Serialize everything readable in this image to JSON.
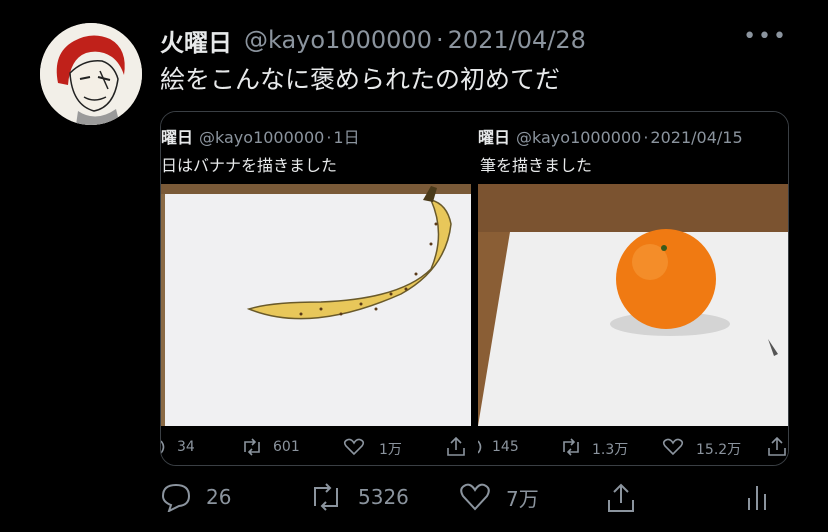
{
  "tweet": {
    "author_name": "火曜日",
    "handle": "@kayo1000000",
    "date": "2021/04/28",
    "text": "絵をこんなに褒められたの初めてだ"
  },
  "quoted": [
    {
      "name": "曜日",
      "handle": "@kayo1000000",
      "time": "1日",
      "text": "日はバナナを描きました",
      "replies": "34",
      "retweets": "601",
      "likes": "1万"
    },
    {
      "name": "曜日",
      "handle": "@kayo1000000",
      "time": "2021/04/15",
      "text": "筆を描きました",
      "replies": "145",
      "retweets": "1.3万",
      "likes": "15.2万"
    }
  ],
  "actions": {
    "replies": "26",
    "retweets": "5326",
    "likes": "7万"
  },
  "icons": {
    "more": "more-icon",
    "reply": "reply-icon",
    "retweet": "retweet-icon",
    "like": "heart-icon",
    "share": "share-icon",
    "analytics": "analytics-icon"
  },
  "colors": {
    "background": "#000000",
    "text": "#e7e9ea",
    "muted": "#8b949e"
  }
}
